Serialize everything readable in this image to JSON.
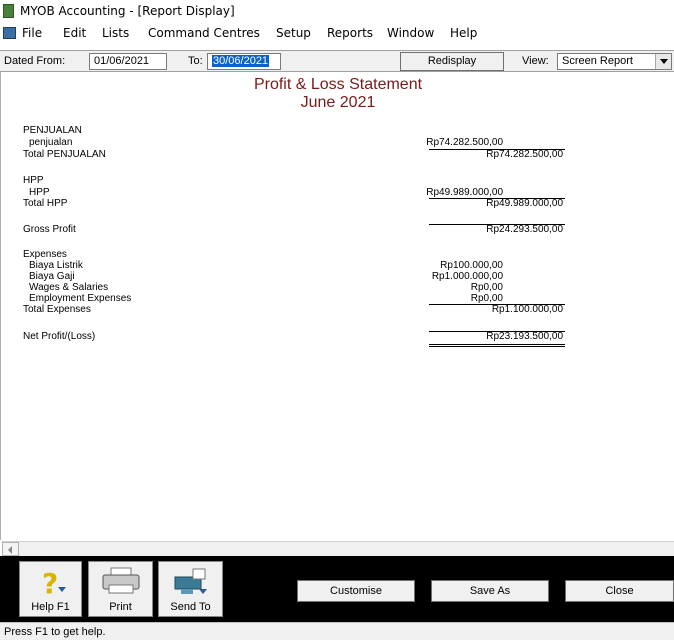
{
  "window": {
    "title": "MYOB Accounting - [Report Display]"
  },
  "menu": [
    "File",
    "Edit",
    "Lists",
    "Command Centres",
    "Setup",
    "Reports",
    "Window",
    "Help"
  ],
  "toolbar": {
    "dated_from_label": "Dated From:",
    "dated_from_value": "01/06/2021",
    "to_label": "To:",
    "to_value": "30/06/2021",
    "redisplay_label": "Redisplay",
    "view_label": "View:",
    "view_value": "Screen Report"
  },
  "report": {
    "title": "Profit & Loss Statement",
    "subtitle": "June 2021",
    "penjualan": {
      "header": "PENJUALAN",
      "rows": [
        {
          "label": "penjualan",
          "amount": "Rp74.282.500,00"
        }
      ],
      "total_label": "Total PENJUALAN",
      "total_amount": "Rp74.282.500,00"
    },
    "hpp": {
      "header": "HPP",
      "rows": [
        {
          "label": "HPP",
          "amount": "Rp49.989.000,00"
        }
      ],
      "total_label": "Total HPP",
      "total_amount": "Rp49.989.000,00"
    },
    "gross_profit": {
      "label": "Gross Profit",
      "amount": "Rp24.293.500,00"
    },
    "expenses": {
      "header": "Expenses",
      "rows": [
        {
          "label": "Biaya Listrik",
          "amount": "Rp100.000,00"
        },
        {
          "label": "Biaya Gaji",
          "amount": "Rp1.000.000,00"
        },
        {
          "label": "Wages & Salaries",
          "amount": "Rp0,00"
        },
        {
          "label": "Employment Expenses",
          "amount": "Rp0,00"
        }
      ],
      "total_label": "Total Expenses",
      "total_amount": "Rp1.100.000,00"
    },
    "net_profit": {
      "label": "Net Profit/(Loss)",
      "amount": "Rp23.193.500,00"
    }
  },
  "bottom": {
    "help_label": "Help F1",
    "print_label": "Print",
    "send_label": "Send To",
    "customise_label": "Customise",
    "save_as_label": "Save As",
    "close_label": "Close"
  },
  "status": {
    "text": "Press F1 to get help."
  }
}
